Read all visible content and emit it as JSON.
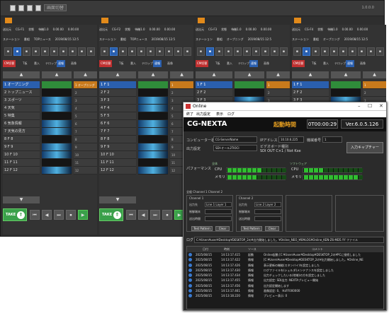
{
  "topbar": {
    "label": "画面切替",
    "version": "1.0.0.0"
  },
  "columns": [
    {
      "header1": [
        "送出元",
        "CG-F1",
        "状態",
        "待機1.0",
        "0.00.00",
        "0.00.00"
      ],
      "header2": [
        "ステーション",
        "番組",
        "TOPニュース",
        "2019/08/15 12:5"
      ],
      "cats": [
        "CM切替",
        "T板",
        "番入",
        "テロップ",
        "速報",
        "画像"
      ],
      "items": [
        "1 オープニング",
        "2 トップニュース",
        "3 スポーツ",
        "4 天気",
        "5 特集",
        "6 気象情報",
        "7 天気の見方",
        "8 F 8",
        "9 F 9",
        "10 F 10",
        "11 F 11",
        "12 F 12"
      ],
      "pane": [
        "1 オープニング",
        "2",
        "3",
        "4",
        "5",
        "6",
        "7",
        "8",
        "9",
        "10",
        "11",
        "12"
      ],
      "take": "TAKE"
    },
    {
      "header1": [
        "送出元",
        "CG-F2",
        "状態",
        "待機1.0",
        "0.00.00",
        "0.00.00"
      ],
      "header2": [
        "ステーション",
        "番組",
        "TOPニュース",
        "2019/08/15 12:5"
      ],
      "cats": [
        "CM切替",
        "T板",
        "番入",
        "テロップ",
        "速報",
        "画像"
      ],
      "items": [
        "1 F 1",
        "2 F 2",
        "3 F 3",
        "4 F 4",
        "5 F 5",
        "6 F 6",
        "7 F 7",
        "8 F 8",
        "9 F 9",
        "10 F 10",
        "11 F 11",
        "12 F 12"
      ],
      "pane": [
        "1",
        "2",
        "3",
        "4",
        "5",
        "6",
        "7",
        "8",
        "9",
        "10",
        "11",
        "12"
      ],
      "take": "TAKE"
    },
    {
      "header1": [
        "送出元",
        "CG-F3",
        "状態",
        "待機1.0",
        "0.00.00",
        "0.00.00"
      ],
      "header2": [
        "ステーション",
        "番組",
        "オープニング",
        "2019/08/15 12:5"
      ],
      "cats": [
        "CM切替",
        "T板",
        "番入",
        "テロップ",
        "速報",
        "画像"
      ],
      "items": [
        "1 F 1",
        "2 F 2",
        "3 F 3",
        "4 F 4",
        "5 F 5",
        "6 F 6",
        "7 F 7",
        "8 F 8",
        "9 F 9",
        "10 F 10",
        "11 F 11",
        "12 F 12"
      ],
      "pane": [
        "1",
        "2",
        "3",
        "4",
        "5",
        "6",
        "7",
        "8",
        "9",
        "10",
        "11",
        "12"
      ],
      "take": "TAKE"
    },
    {
      "header1": [
        "送出元",
        "CG-F4",
        "状態",
        "待機1.0",
        "0.00.00",
        "0.00.00"
      ],
      "header2": [
        "ステーション",
        "番組",
        "オープニング",
        "2019/08/15 12:5"
      ],
      "cats": [
        "CM切替",
        "T板",
        "番入",
        "テロップ",
        "速報",
        "画像"
      ],
      "items": [
        "1 F 1",
        "2 F 2",
        "3 F 3",
        "4 F 4",
        "5 F 5",
        "6 F 6",
        "7 F 7",
        "8 F 8",
        "9 F 9",
        "10 F 10",
        "11 F 11",
        "12 F 12"
      ],
      "pane": [
        "1",
        "2",
        "3",
        "4",
        "5",
        "6",
        "7",
        "8",
        "9",
        "10",
        "11",
        "12"
      ],
      "take": "TAKE"
    }
  ],
  "dialog": {
    "title": "Online",
    "menu": [
      "終了",
      "出力設定",
      "表示",
      "ログ"
    ],
    "app_name": "CG-NEXTA",
    "start_label": "起動時間",
    "start_time": "0T00:00:29",
    "version": "Ver.6.0.5.126",
    "computer_label": "コンピューター名",
    "computer_value": "CG-ServerName",
    "ip_label": "IPアドレス",
    "ip_value": "10.10.6.225",
    "machine_label": "機械番号",
    "machine_value": "1",
    "output_label": "出力設定",
    "output_value": "SDI-オール2TIOCI",
    "video_label": "ビデオボード種別",
    "video_value": "SDI OUT C×1 / Not Kxe",
    "capture_button": "入力キャプチャー",
    "perf_label": "パフォーマンス",
    "hw_label": "全体",
    "sw_label": "ソフトウェア",
    "cpu_label": "CPU",
    "mem_label": "メモリ",
    "cpu1_level": 0.55,
    "mem1_level": 0.5,
    "cpu2_level": 0.35,
    "mem2_level": 0.95,
    "tabs": "全般  Channel 1  Channel 2",
    "ch1": {
      "title": "Channel 1",
      "out_label": "出力先",
      "out_value": "Line 1 Layer 1",
      "ctrl_label": "制御端末",
      "time_label": "送出時間",
      "test": "Test Pattern",
      "clear": "Clear"
    },
    "ch2": {
      "title": "Channel 2",
      "out_label": "出力先",
      "out_value": "Line 2 Layer 2",
      "ctrl_label": "制御端末",
      "time_label": "送出時間",
      "test": "Test Pattern",
      "clear": "Clear"
    },
    "log_label": "ログ",
    "log_path": "C:¥Users¥user¥Desktop¥DESKTOP_2の¥出力開始しました。¥Online_NEO_¥IB¥LOG¥Online_KEN-Z6-MD5.YY ファイル",
    "log_headers": [
      "日付",
      "時刻",
      "ソース",
      "コメント"
    ],
    "log_rows": [
      [
        "2025/08/15",
        "14:13:17.415",
        "起動",
        "Online起動 [C:¥Users¥user¥Desktop¥DESKTOP_2の¥PCに接続しました"
      ],
      [
        "2025/08/15",
        "14:13:17.422",
        "情報",
        "[C:¥Users¥user¥Desktop¥DESKTOP_2の¥出力開始しました。¥Online_NE"
      ],
      [
        "2025/08/15",
        "14:13:17.426",
        "情報",
        "表示更新の機能(スタンバイ)を設定しました"
      ],
      [
        "2025/08/15",
        "14:13:17.430",
        "情報",
        "ログファイルを(シェルダ)メンテナンスを設定しました"
      ],
      [
        "2025/08/15",
        "14:13:17.434",
        "情報",
        "出力チェックしたいる(地域)の方を設定しました"
      ],
      [
        "2025/08/15",
        "14:13:17.455",
        "情報",
        "出力設定: SDI出力: NEXTAプレビュー開始"
      ],
      [
        "2025/08/15",
        "14:13:17.456",
        "情報",
        "出力設定開始します"
      ],
      [
        "2025/08/15",
        "14:13:17.461",
        "情報",
        "画像設定: 0、 HzFF000000"
      ],
      [
        "2025/08/15",
        "14:13:18.220",
        "情報",
        "プレビュー表示: 0"
      ]
    ]
  }
}
